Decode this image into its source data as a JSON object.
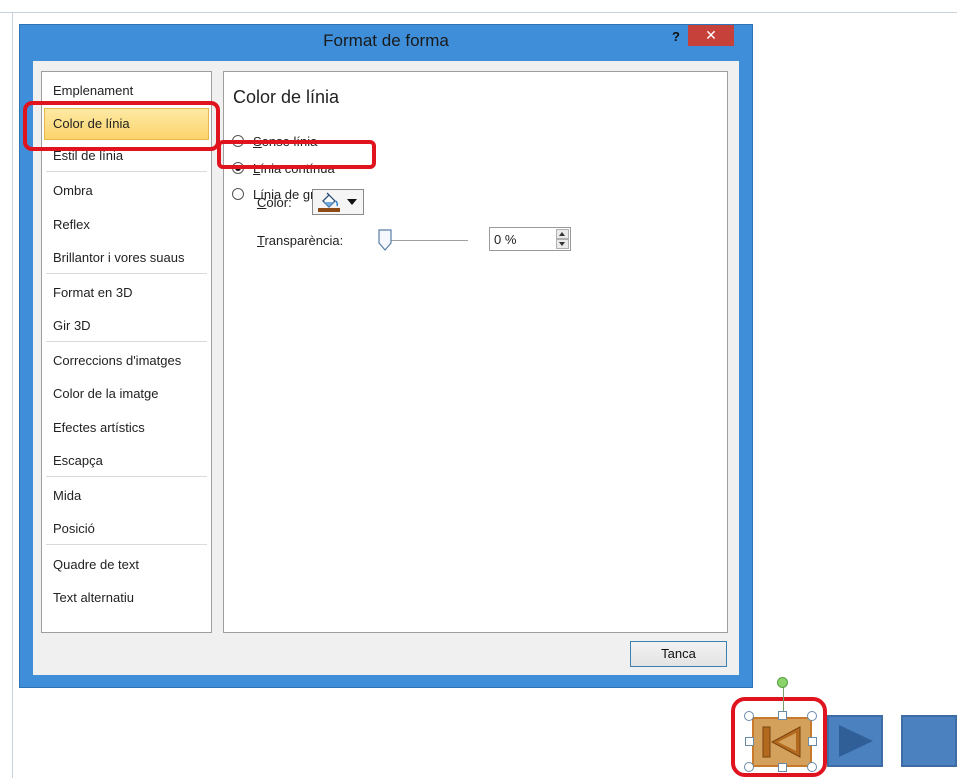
{
  "dialog": {
    "title": "Format de forma",
    "help_label": "?",
    "close_glyph": "✕",
    "close_button_label": "Tanca"
  },
  "nav": {
    "items": [
      {
        "label": "Emplenament",
        "selected": false
      },
      {
        "label": "Color de línia",
        "selected": true
      },
      {
        "label": "Estil de línia",
        "selected": false
      },
      {
        "label": "Ombra",
        "selected": false
      },
      {
        "label": "Reflex",
        "selected": false
      },
      {
        "label": "Brillantor i vores suaus",
        "selected": false
      },
      {
        "label": "Format en 3D",
        "selected": false
      },
      {
        "label": "Gir 3D",
        "selected": false
      },
      {
        "label": "Correccions d'imatges",
        "selected": false
      },
      {
        "label": "Color de la imatge",
        "selected": false
      },
      {
        "label": "Efectes artístics",
        "selected": false
      },
      {
        "label": "Escapça",
        "selected": false
      },
      {
        "label": "Mida",
        "selected": false
      },
      {
        "label": "Posició",
        "selected": false
      },
      {
        "label": "Quadre de text",
        "selected": false
      },
      {
        "label": "Text alternatiu",
        "selected": false
      }
    ]
  },
  "panel": {
    "title": "Color de línia",
    "options": [
      {
        "key": "S",
        "rest": "ense línia",
        "checked": false
      },
      {
        "key": "L",
        "rest": "ínia contínua",
        "checked": true
      },
      {
        "pre": "Línia de ",
        "key": "g",
        "rest": "radient",
        "checked": false
      }
    ],
    "color_label_key": "C",
    "color_label_rest": "olor:",
    "transparency_label_key": "T",
    "transparency_label_rest": "ransparència:",
    "transparency_value": "0 %",
    "transparency_level": 0
  },
  "colors": {
    "dialog_frame": "#3e8ed9",
    "close_red": "#c7413b",
    "annotation_red": "#e0141e",
    "selected_item": "#fcd46c",
    "shape_orange": "#d3a15b",
    "shape_blue": "#4c81c0",
    "line_color_swatch": "#8e4b16"
  },
  "icons": [
    "paint-bucket-icon",
    "dropdown-arrow-icon",
    "spin-up-icon",
    "spin-down-icon",
    "close-icon",
    "help-icon",
    "first-slide-icon",
    "play-icon",
    "stop-icon"
  ]
}
